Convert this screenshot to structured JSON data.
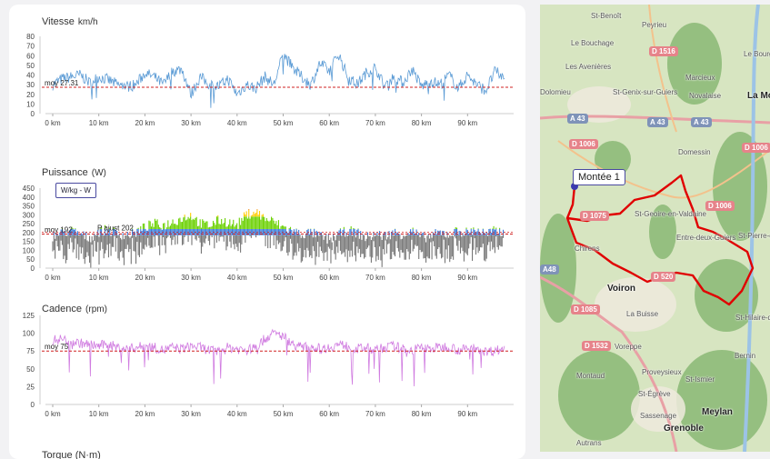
{
  "colors": {
    "speed": "#5b9bd5",
    "cadence": "#d07be0",
    "power_low": "#777777",
    "power_mid": "#3a7ad9",
    "power_high": "#6ad000",
    "power_peak": "#ffcc00",
    "power_max": "#e03030",
    "avg_line": "#d02020"
  },
  "chart_data": [
    {
      "type": "line",
      "title": "Vitesse",
      "unit": "km/h",
      "xlabel": "",
      "ylabel": "",
      "x_unit": "km",
      "xlim": [
        0,
        100
      ],
      "ylim": [
        0,
        80
      ],
      "x_ticks": [
        "0 km",
        "10 km",
        "20 km",
        "30 km",
        "40 km",
        "50 km",
        "60 km",
        "70 km",
        "80 km",
        "90 km"
      ],
      "y_ticks": [
        "0",
        "10",
        "20",
        "30",
        "40",
        "50",
        "60",
        "70",
        "80"
      ],
      "average": 27.31,
      "average_label": "moy 27.31",
      "series": [
        {
          "x": [
            0,
            2,
            4,
            6,
            8,
            10,
            12,
            14,
            16,
            18,
            20,
            22,
            24,
            26,
            28,
            30,
            32,
            34,
            36,
            38,
            40,
            42,
            44,
            46,
            48,
            50,
            52,
            54,
            56,
            58,
            60,
            62,
            64,
            66,
            68,
            70,
            72,
            74,
            76,
            78,
            80,
            82,
            84,
            86,
            88,
            90,
            92,
            94,
            96,
            98,
            100
          ],
          "values": [
            30,
            36,
            38,
            40,
            32,
            38,
            35,
            30,
            28,
            30,
            42,
            38,
            30,
            44,
            46,
            20,
            38,
            30,
            28,
            36,
            20,
            30,
            26,
            38,
            30,
            62,
            48,
            38,
            30,
            52,
            44,
            62,
            38,
            30,
            42,
            48,
            28,
            38,
            32,
            46,
            28,
            34,
            30,
            40,
            26,
            40,
            30,
            24,
            44,
            36,
            30
          ]
        }
      ]
    },
    {
      "type": "bar",
      "title": "Puissance",
      "unit": "(W)",
      "xlabel": "",
      "ylabel": "",
      "x_unit": "km",
      "xlim": [
        0,
        100
      ],
      "ylim": [
        0,
        450
      ],
      "x_ticks": [
        "0 km",
        "10 km",
        "20 km",
        "30 km",
        "40 km",
        "50 km",
        "60 km",
        "70 km",
        "80 km",
        "90 km"
      ],
      "y_ticks": [
        "0",
        "50",
        "100",
        "150",
        "200",
        "250",
        "300",
        "350",
        "400",
        "450"
      ],
      "average": 192,
      "average_label": "moy 192",
      "adjusted": 202,
      "adjusted_label": "P ajust 202",
      "toggle_label": "W/kg - W",
      "series": [
        {
          "x": [
            0,
            2,
            4,
            6,
            8,
            10,
            12,
            14,
            16,
            18,
            20,
            22,
            24,
            26,
            28,
            30,
            32,
            34,
            36,
            38,
            40,
            42,
            44,
            46,
            48,
            50,
            52,
            54,
            56,
            58,
            60,
            62,
            64,
            66,
            68,
            70,
            72,
            74,
            76,
            78,
            80,
            82,
            84,
            86,
            88,
            90,
            92,
            94,
            96,
            98,
            100
          ],
          "values": [
            180,
            200,
            210,
            190,
            170,
            205,
            215,
            195,
            185,
            200,
            230,
            250,
            240,
            260,
            280,
            300,
            250,
            240,
            270,
            260,
            240,
            300,
            320,
            280,
            260,
            230,
            210,
            190,
            200,
            180,
            160,
            190,
            210,
            200,
            170,
            190,
            180,
            200,
            190,
            210,
            170,
            180,
            200,
            190,
            210,
            200,
            220,
            190,
            210,
            200,
            190
          ]
        }
      ]
    },
    {
      "type": "line",
      "title": "Cadence",
      "unit": "(rpm)",
      "xlabel": "",
      "ylabel": "",
      "x_unit": "km",
      "xlim": [
        0,
        100
      ],
      "ylim": [
        0,
        125
      ],
      "x_ticks": [
        "0 km",
        "10 km",
        "20 km",
        "30 km",
        "40 km",
        "50 km",
        "60 km",
        "70 km",
        "80 km",
        "90 km"
      ],
      "y_ticks": [
        "0",
        "25",
        "50",
        "75",
        "100",
        "125"
      ],
      "average": 75,
      "average_label": "moy 75",
      "series": [
        {
          "x": [
            0,
            2,
            4,
            6,
            8,
            10,
            12,
            14,
            16,
            18,
            20,
            22,
            24,
            26,
            28,
            30,
            32,
            34,
            36,
            38,
            40,
            42,
            44,
            46,
            48,
            50,
            52,
            54,
            56,
            58,
            60,
            62,
            64,
            66,
            68,
            70,
            72,
            74,
            76,
            78,
            80,
            82,
            84,
            86,
            88,
            90,
            92,
            94,
            96,
            98,
            100
          ],
          "values": [
            90,
            92,
            88,
            86,
            84,
            82,
            85,
            80,
            78,
            80,
            82,
            80,
            76,
            80,
            78,
            82,
            80,
            76,
            74,
            80,
            78,
            76,
            80,
            92,
            100,
            96,
            85,
            80,
            82,
            78,
            80,
            84,
            82,
            78,
            80,
            76,
            80,
            82,
            78,
            76,
            80,
            78,
            80,
            82,
            76,
            78,
            80,
            74,
            76,
            78,
            78
          ]
        }
      ]
    }
  ],
  "next_chart_title": "Torque (N·m)",
  "map": {
    "climb_label": "Montée 1",
    "places": [
      {
        "name": "St-Benoît",
        "big": false
      },
      {
        "name": "Peyrieu",
        "big": false
      },
      {
        "name": "Le Bouchage",
        "big": false
      },
      {
        "name": "Les Avenières",
        "big": false
      },
      {
        "name": "Marcieux",
        "big": false
      },
      {
        "name": "Novalaise",
        "big": false
      },
      {
        "name": "St-Genix-sur-Guiers",
        "big": false
      },
      {
        "name": "Dolomieu",
        "big": false
      },
      {
        "name": "La Motte-Servolex",
        "big": true
      },
      {
        "name": "Le Bourget-du-Lac",
        "big": false
      },
      {
        "name": "Domessin",
        "big": false
      },
      {
        "name": "St-Geoire-en-Valdaine",
        "big": false
      },
      {
        "name": "Entre-deux-Guiers",
        "big": false
      },
      {
        "name": "St-Pierre-d'Entremont",
        "big": false
      },
      {
        "name": "Voiron",
        "big": true
      },
      {
        "name": "La Buisse",
        "big": false
      },
      {
        "name": "St-Hilaire-du-Touvet",
        "big": false
      },
      {
        "name": "Bernin",
        "big": false
      },
      {
        "name": "Voreppe",
        "big": false
      },
      {
        "name": "Proveysieux",
        "big": false
      },
      {
        "name": "St-Ismier",
        "big": false
      },
      {
        "name": "Montaud",
        "big": false
      },
      {
        "name": "St-Égrève",
        "big": false
      },
      {
        "name": "Sassenage",
        "big": false
      },
      {
        "name": "Meylan",
        "big": true
      },
      {
        "name": "Grenoble",
        "big": true
      },
      {
        "name": "Autrans",
        "big": false
      },
      {
        "name": "Chirens",
        "big": false
      }
    ],
    "roads": [
      "D 1516",
      "A 43",
      "A 43",
      "A 43",
      "D 1006",
      "D 1006",
      "D 1006",
      "D 1075",
      "D 520",
      "D 1085",
      "D 1532",
      "A48"
    ]
  }
}
